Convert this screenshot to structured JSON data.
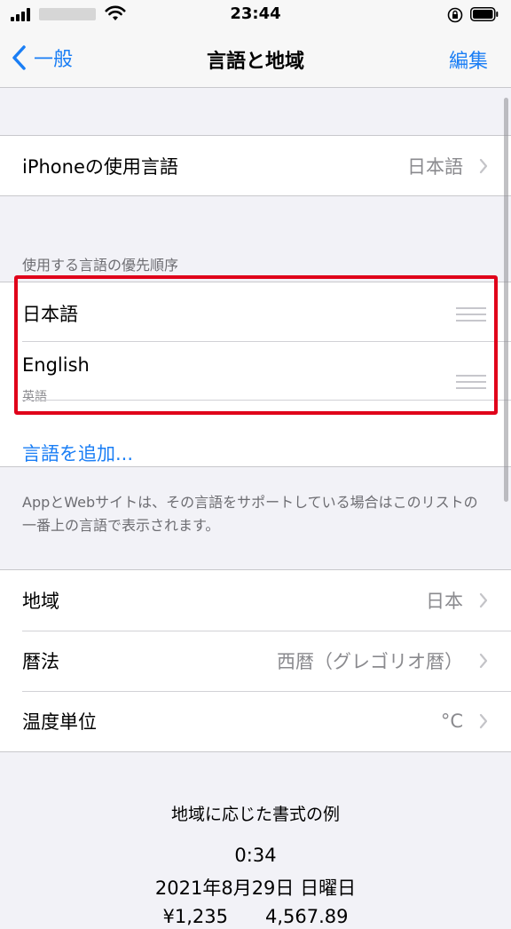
{
  "status_bar": {
    "time": "23:44",
    "icons": [
      "signal-icon",
      "wifi-icon",
      "orientation-lock-icon",
      "battery-icon"
    ]
  },
  "nav": {
    "back_label": "一般",
    "title": "言語と地域",
    "edit_label": "編集"
  },
  "iphone_language": {
    "label": "iPhoneの使用言語",
    "value": "日本語"
  },
  "preferred_languages": {
    "header": "使用する言語の優先順序",
    "items": [
      {
        "name": "日本語",
        "subtitle": ""
      },
      {
        "name": "English",
        "subtitle": "英語"
      }
    ],
    "add_label": "言語を追加...",
    "footer": "AppとWebサイトは、その言語をサポートしている場合はこのリストの一番上の言語で表示されます。"
  },
  "region_settings": [
    {
      "label": "地域",
      "value": "日本"
    },
    {
      "label": "暦法",
      "value": "西暦（グレゴリオ暦）"
    },
    {
      "label": "温度単位",
      "value": "°C"
    }
  ],
  "format_example": {
    "title": "地域に応じた書式の例",
    "time": "0:34",
    "date": "2021年8月29日 日曜日",
    "numbers": "¥1,235　　4,567.89"
  },
  "colors": {
    "accent": "#1a7ef5",
    "highlight_border": "#e0001a",
    "background": "#f2f2f7"
  }
}
